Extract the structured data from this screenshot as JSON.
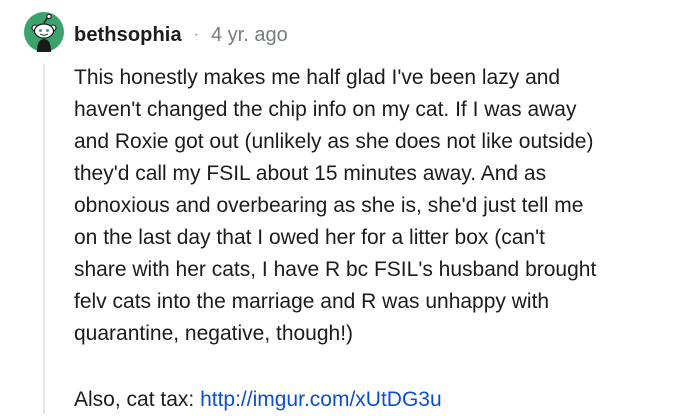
{
  "comment": {
    "username": "bethsophia",
    "separator": "·",
    "timestamp": "4 yr. ago",
    "avatar_icon": "reddit-snoo-avatar-icon",
    "accent_color": "#3aa36b",
    "lines": [
      "This honestly makes me half glad I've been lazy and",
      "haven't changed the chip info on my cat. If I was away",
      "and Roxie got out (unlikely as she does not like outside)",
      "they'd call my FSIL about 15 minutes away. And as",
      "obnoxious and overbearing as she is, she'd just tell me",
      "on the last day that I owed her for a litter box (can't",
      "share with her cats, I have R bc FSIL's husband brought",
      "felv cats into the marriage and R was unhappy with",
      "quarantine, negative, though!)"
    ],
    "footer_prefix": "Also, cat tax: ",
    "footer_link": "http://imgur.com/xUtDG3u"
  }
}
